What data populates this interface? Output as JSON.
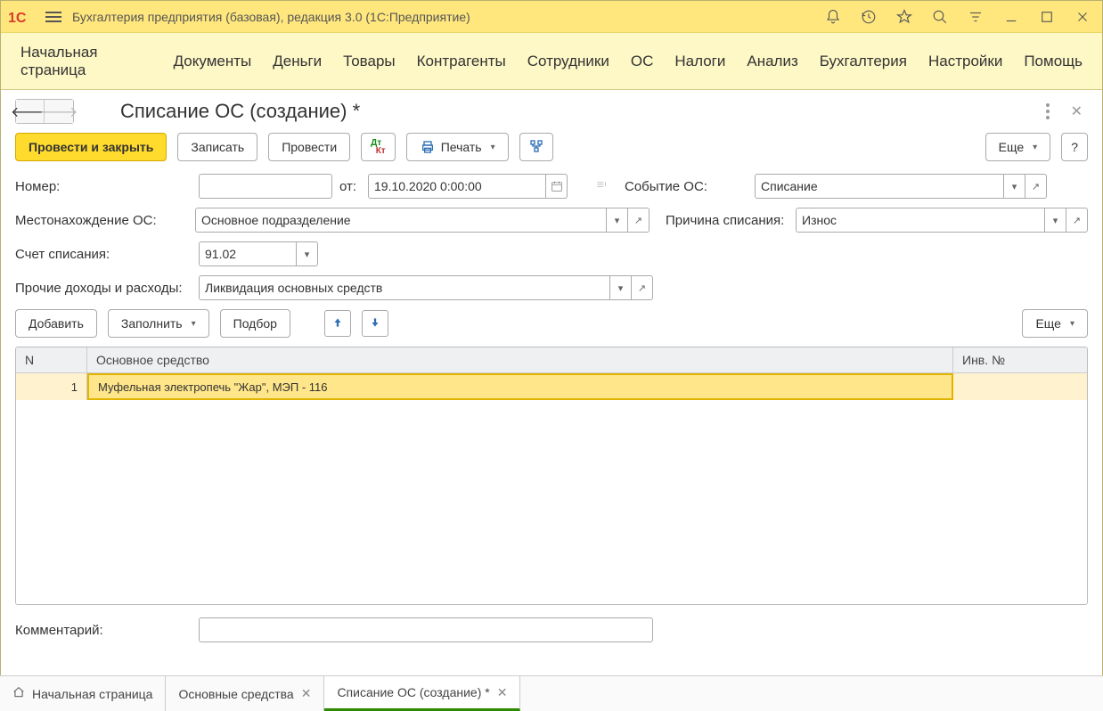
{
  "titlebar": {
    "app_title": "Бухгалтерия предприятия (базовая), редакция 3.0  (1С:Предприятие)"
  },
  "menu": {
    "items": [
      "Начальная страница",
      "Документы",
      "Деньги",
      "Товары",
      "Контрагенты",
      "Сотрудники",
      "ОС",
      "Налоги",
      "Анализ",
      "Бухгалтерия",
      "Настройки",
      "Помощь"
    ]
  },
  "doc": {
    "title": "Списание ОС (создание) *"
  },
  "toolbar": {
    "post_close": "Провести и закрыть",
    "save": "Записать",
    "post": "Провести",
    "print": "Печать",
    "more": "Еще",
    "help": "?"
  },
  "form": {
    "number_label": "Номер:",
    "number_value": "",
    "from_label": "от:",
    "date_value": "19.10.2020  0:00:00",
    "event_label": "Событие ОС:",
    "event_value": "Списание",
    "location_label": "Местонахождение ОС:",
    "location_value": "Основное подразделение",
    "reason_label": "Причина списания:",
    "reason_value": "Износ",
    "account_label": "Счет списания:",
    "account_value": "91.02",
    "other_label": "Прочие доходы и расходы:",
    "other_value": "Ликвидация основных средств",
    "comment_label": "Комментарий:",
    "comment_value": ""
  },
  "table_toolbar": {
    "add": "Добавить",
    "fill": "Заполнить",
    "pick": "Подбор",
    "more": "Еще"
  },
  "table": {
    "columns": {
      "n": "N",
      "asset": "Основное средство",
      "inv": "Инв. №"
    },
    "rows": [
      {
        "n": "1",
        "asset": "Муфельная электропечь \"Жар\", МЭП - 116",
        "inv": ""
      }
    ]
  },
  "tabs": {
    "items": [
      {
        "label": "Начальная страница",
        "closable": false,
        "home": true
      },
      {
        "label": "Основные средства",
        "closable": true
      },
      {
        "label": "Списание ОС (создание) *",
        "closable": true,
        "active": true
      }
    ]
  }
}
